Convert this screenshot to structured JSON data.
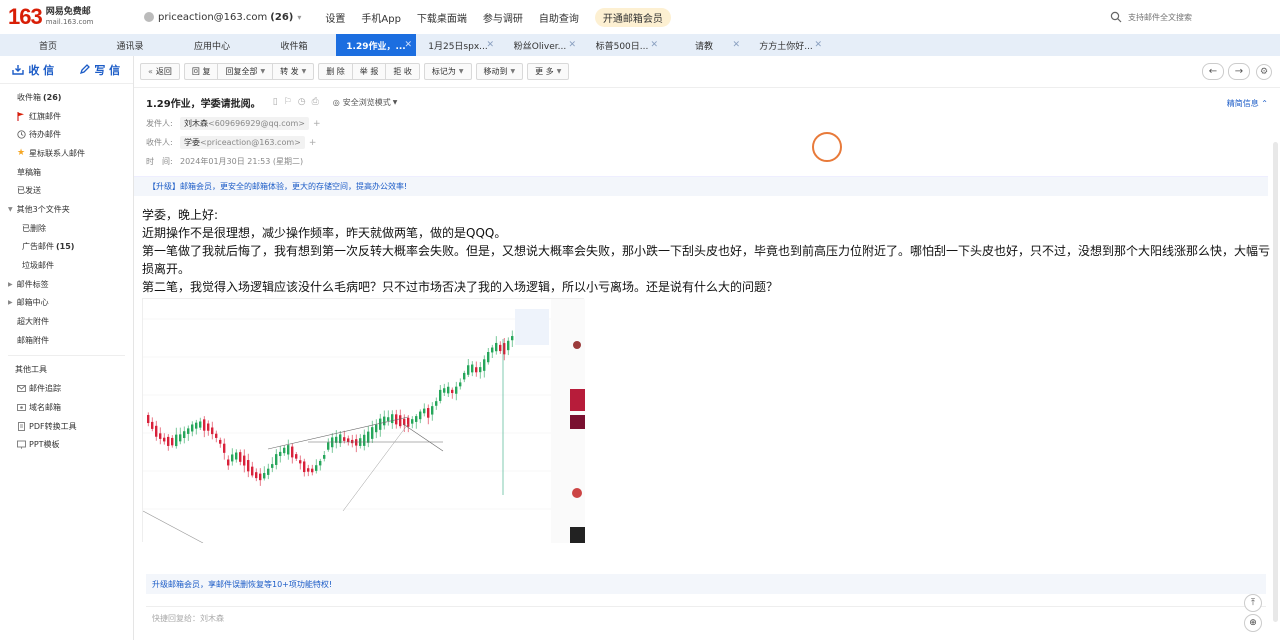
{
  "header": {
    "logo_number": "163",
    "logo_line1": "网易免费邮",
    "logo_line2": "mail.163.com",
    "account_email": "priceaction@163.com",
    "account_count": "(26)",
    "nav": [
      "设置",
      "手机App",
      "下载桌面端",
      "参与调研",
      "自助查询"
    ],
    "vip_button": "开通邮箱会员",
    "search_placeholder": "支持邮件全文搜索"
  },
  "tabs": [
    {
      "label": "首页",
      "active": false
    },
    {
      "label": "通讯录",
      "active": false
    },
    {
      "label": "应用中心",
      "active": false
    },
    {
      "label": "收件箱",
      "active": false
    },
    {
      "label": "1.29作业，...",
      "active": true
    },
    {
      "label": "1月25日spx...",
      "active": false
    },
    {
      "label": "粉丝Oliver...",
      "active": false
    },
    {
      "label": "标普500日...",
      "active": false
    },
    {
      "label": "请教",
      "active": false
    },
    {
      "label": "方方土你好...",
      "active": false
    }
  ],
  "sidebar": {
    "receive": "收 信",
    "compose": "写 信",
    "items": [
      {
        "label": "收件箱",
        "count": "(26)",
        "type": "item"
      },
      {
        "label": "红旗邮件",
        "type": "item",
        "icon": "flag"
      },
      {
        "label": "待办邮件",
        "type": "item",
        "icon": "clock"
      },
      {
        "label": "星标联系人邮件",
        "type": "item",
        "icon": "star"
      },
      {
        "label": "草稿箱",
        "type": "item"
      },
      {
        "label": "已发送",
        "type": "item"
      },
      {
        "label": "其他3个文件夹",
        "type": "group"
      },
      {
        "label": "已删除",
        "type": "sub"
      },
      {
        "label": "广告邮件",
        "count": "(15)",
        "type": "sub"
      },
      {
        "label": "垃圾邮件",
        "type": "sub"
      },
      {
        "label": "邮件标签",
        "type": "group"
      },
      {
        "label": "邮箱中心",
        "type": "group"
      },
      {
        "label": "超大附件",
        "type": "item"
      },
      {
        "label": "邮箱附件",
        "type": "item"
      }
    ],
    "tools_title": "其他工具",
    "tools": [
      {
        "label": "邮件追踪",
        "icon": "track"
      },
      {
        "label": "域名邮箱",
        "icon": "domain"
      },
      {
        "label": "PDF转换工具",
        "icon": "pdf"
      },
      {
        "label": "PPT模板",
        "icon": "ppt"
      }
    ]
  },
  "toolbar": {
    "back": "返回",
    "reply": "回 复",
    "reply_all": "回复全部",
    "forward": "转 发",
    "delete": "删 除",
    "report": "举 报",
    "reject": "拒 收",
    "mark_as": "标记为",
    "move_to": "移动到",
    "more": "更 多"
  },
  "mail": {
    "subject": "1.29作业，学委请批阅。",
    "safe_mode": "安全浏览模式",
    "info_link": "精简信息",
    "from_label": "发件人:",
    "from_name": "刘木森",
    "from_addr": "<609696929@qq.com>",
    "to_label": "收件人:",
    "to_name": "学委",
    "to_addr": "<priceaction@163.com>",
    "time_label": "时　间:",
    "time_value": "2024年01月30日 21:53 (星期二)",
    "upgrade_banner": "【升级】邮箱会员，更安全的邮箱体验，更大的存储空间，提高办公效率!",
    "body": [
      "学委，晚上好:",
      "近期操作不是很理想，减少操作频率，昨天就做两笔，做的是QQQ。",
      "第一笔做了我就后悔了，我有想到第一次反转大概率会失败。但是，又想说大概率会失败，那小跌一下刮头皮也好，毕竟也到前高压力位附近了。哪怕刮一下头皮也好，只不过，没想到那个大阳线涨那么快，大幅亏损离开。",
      "第二笔，我觉得入场逻辑应该没什么毛病吧？只不过市场否决了我的入场逻辑，所以小亏离场。还是说有什么大的问题？"
    ],
    "bottom_banner": "升级邮箱会员，享邮件误删恢复等10+项功能特权!",
    "reply_placeholder": "快捷回复给：刘木森"
  },
  "colors": {
    "accent": "#1c6ee0",
    "logo": "#d81e06",
    "tab_bar": "#e6eef8",
    "up_candle": "#26a65b",
    "down_candle": "#d8213a"
  }
}
